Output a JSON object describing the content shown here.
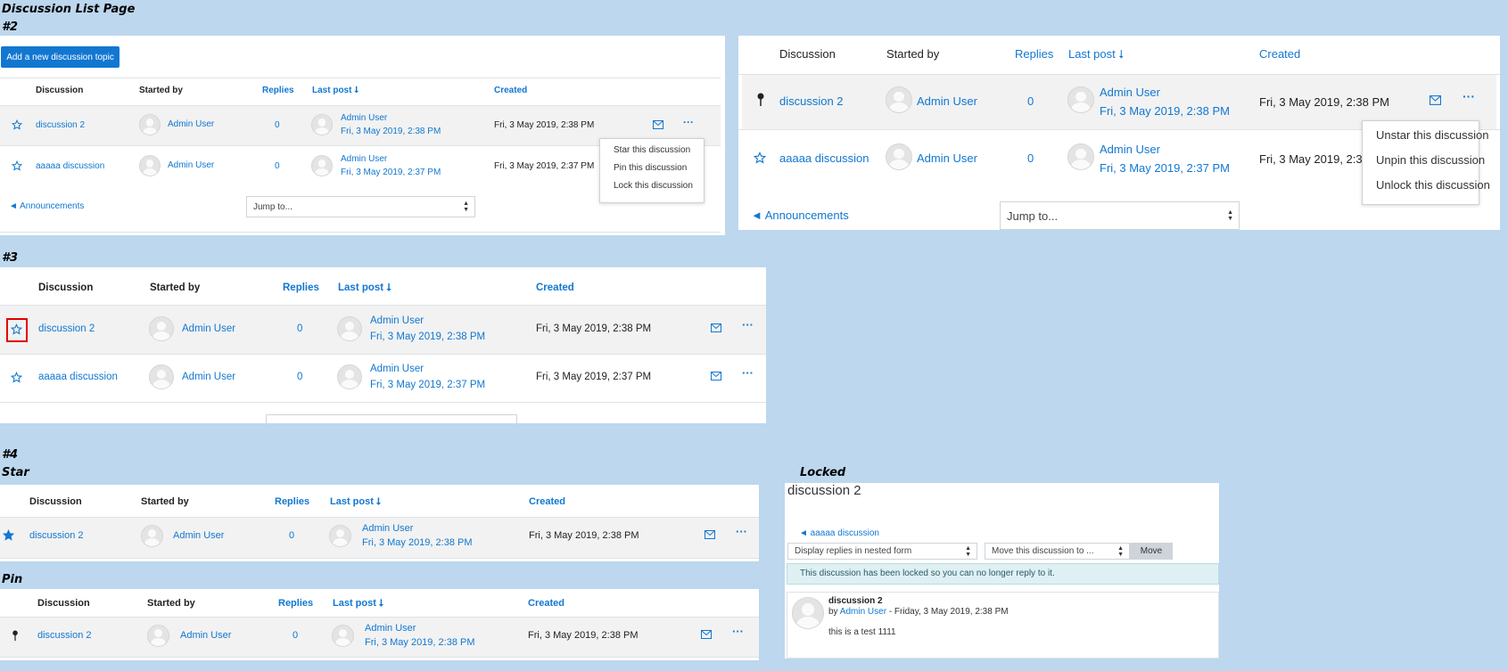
{
  "page_title": "Discussion List Page",
  "labels": {
    "n2": "#2",
    "n3": "#3",
    "n4": "#4",
    "star": "Star",
    "pin": "Pin",
    "locked": "Locked"
  },
  "columns": {
    "discussion": "Discussion",
    "started_by": "Started by",
    "replies": "Replies",
    "last_post": "Last post",
    "created": "Created"
  },
  "sort_arrow": "⭣",
  "add_button": "Add a new discussion topic",
  "rows": [
    {
      "title": "discussion 2",
      "author": "Admin User",
      "replies": "0",
      "last_author": "Admin User",
      "last_date": "Fri, 3 May 2019, 2:38 PM",
      "created": "Fri, 3 May 2019, 2:38 PM"
    },
    {
      "title": "aaaaa discussion",
      "author": "Admin User",
      "replies": "0",
      "last_author": "Admin User",
      "last_date": "Fri, 3 May 2019, 2:37 PM",
      "created": "Fri, 3 May 2019, 2:37 PM"
    }
  ],
  "announcements": "◄ Announcements",
  "jump_to": "Jump to...",
  "menu1": [
    "Star this discussion",
    "Pin this discussion",
    "Lock this discussion"
  ],
  "menu2": [
    "Unstar this discussion",
    "Unpin this discussion",
    "Unlock this discussion"
  ],
  "locked_page": {
    "title": "discussion 2",
    "prev_link": "◄ aaaaa discussion",
    "display_select": "Display replies in nested form",
    "move_select": "Move this discussion to ...",
    "move_button": "Move",
    "notice": "This discussion has been locked so you can no longer reply to it.",
    "post_title": "discussion 2",
    "post_by": "by",
    "post_author": "Admin User",
    "post_date": " - Friday, 3 May 2019, 2:38 PM",
    "post_body": "this is a test 1111"
  },
  "colors": {
    "link": "#1177d1",
    "background": "#bdd7ee",
    "highlight": "#e00000",
    "notice_bg": "#dff0f3"
  }
}
